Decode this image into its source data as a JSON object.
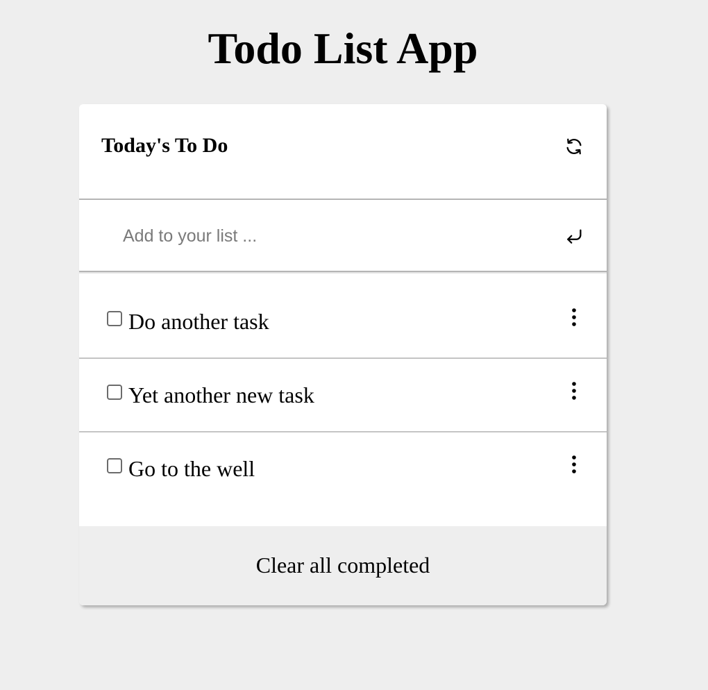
{
  "app": {
    "title": "Todo List App"
  },
  "card": {
    "title": "Today's To Do",
    "refresh_icon": "refresh-icon"
  },
  "add_input": {
    "placeholder": "Add to your list ...",
    "value": "",
    "submit_icon": "enter-return-icon"
  },
  "tasks": [
    {
      "label": "Do another task",
      "checked": false,
      "menu_icon": "more-vertical-icon"
    },
    {
      "label": "Yet another new task",
      "checked": false,
      "menu_icon": "more-vertical-icon"
    },
    {
      "label": "Go to the well",
      "checked": false,
      "menu_icon": "more-vertical-icon"
    }
  ],
  "footer": {
    "clear_label": "Clear all completed"
  },
  "colors": {
    "page_background": "#eeeeee",
    "card_background": "#ffffff",
    "divider": "#b5b5b5",
    "placeholder_text": "#7a7a7a"
  }
}
